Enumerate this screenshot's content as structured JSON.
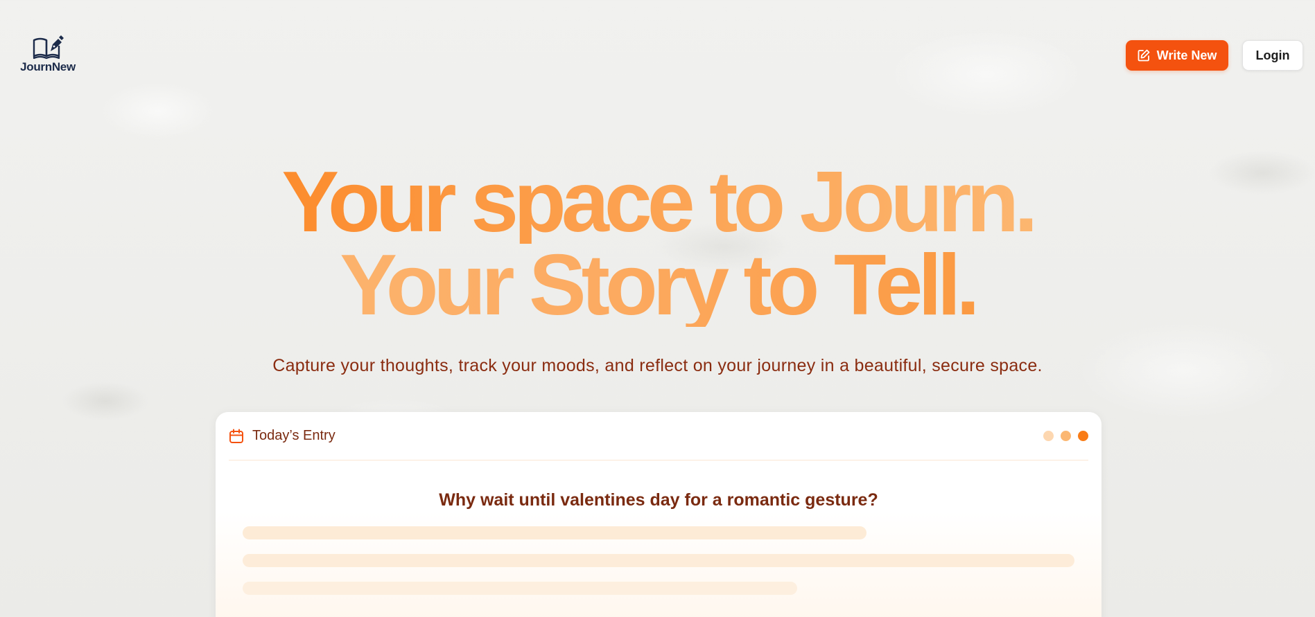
{
  "brand": {
    "name": "JournNew",
    "color": "#1c2b4a"
  },
  "nav": {
    "write_label": "Write New",
    "write_icon": "edit-icon",
    "login_label": "Login",
    "accent": "#f4520f"
  },
  "hero": {
    "line1": "Your space to Journ.",
    "line2": "Your Story to Tell.",
    "subtitle": "Capture your thoughts, track your moods, and reflect on your journey in a beautiful, secure space."
  },
  "entry_card": {
    "icon": "calendar-icon",
    "title": "Today’s Entry",
    "prompt": "Why wait until valentines day for a romantic gesture?",
    "dot_colors": [
      "#fdd7b0",
      "#fbb772",
      "#f97c16"
    ]
  }
}
